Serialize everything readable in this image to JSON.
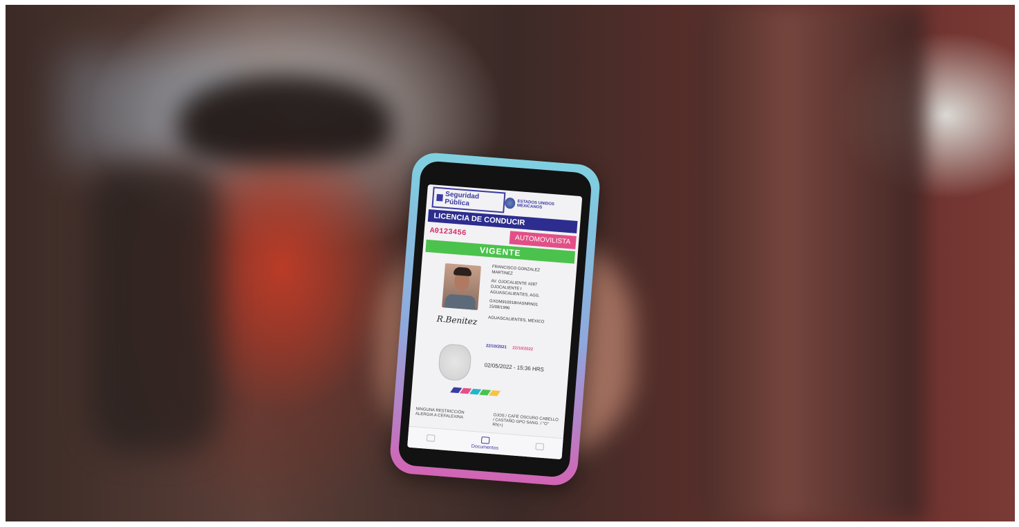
{
  "screen": {
    "brand": "Seguridad Pública",
    "seal_text": "ESTADOS UNIDOS MEXICANOS",
    "doc_title": "LICENCIA DE CONDUCIR",
    "license_number": "A0123456",
    "category": "AUTOMOVILISTA",
    "status": "VIGENTE",
    "name": "FRANCISCO GONZALEZ MARTINEZ",
    "address": "AV. OJOCALIENTE #287 OJOCALIENTE I AGUASCALIENTES, AGS.",
    "curp": "GXOM910918HASNRN01",
    "birth_date": "15/08/1996",
    "birthplace": "AGUASCALIENTES, MÉXICO",
    "issued": "22/10/2021",
    "expires": "22/10/2022",
    "timestamp": "02/05/2022 - 15:36 HRS",
    "restrictions": "NINGUNA RESTRICCIÓN ALERGIA A CEFALEXINA",
    "features": "OJOS / CAFÉ OSCURO CABELLO / CASTAÑO GPO SANG. / \"O\" Rh(+)",
    "tabs": {
      "documents": "Documentos"
    },
    "colors": {
      "navy": "#2c2d8e",
      "pink": "#e24f86",
      "green": "#4bc24c"
    },
    "stripe_colors": [
      "#3b3aa0",
      "#e24f86",
      "#1fb6c9",
      "#4bc24c",
      "#f5c542"
    ]
  }
}
